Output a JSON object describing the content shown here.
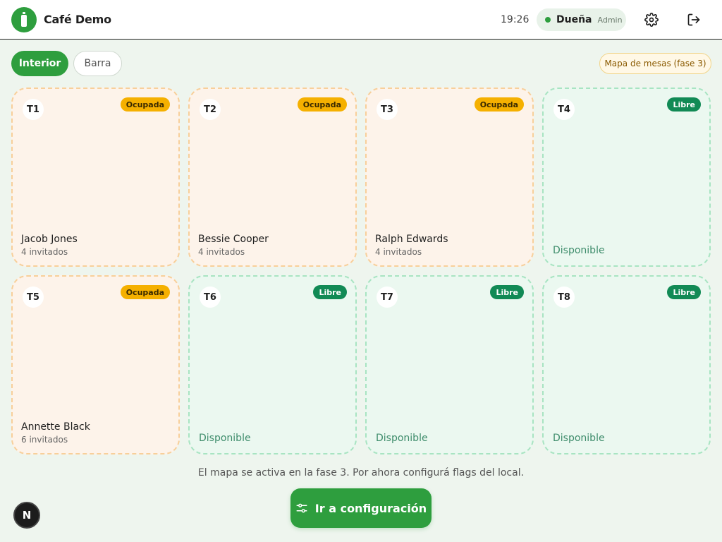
{
  "header": {
    "app_title": "Café Demo",
    "time": "19:26",
    "user_name": "Dueña",
    "user_role": "Admin",
    "brand_color": "#2e9e3e"
  },
  "tabs": [
    {
      "label": "Interior",
      "active": true
    },
    {
      "label": "Barra",
      "active": false
    }
  ],
  "phase_badge": "Mapa de mesas (fase 3)",
  "tables": [
    {
      "id": "T1",
      "status": "Ocupada",
      "guest": "Jacob Jones",
      "count": "4 invitados"
    },
    {
      "id": "T2",
      "status": "Ocupada",
      "guest": "Bessie Cooper",
      "count": "4 invitados"
    },
    {
      "id": "T3",
      "status": "Ocupada",
      "guest": "Ralph Edwards",
      "count": "4 invitados"
    },
    {
      "id": "T4",
      "status": "Libre",
      "available": "Disponible"
    },
    {
      "id": "T5",
      "status": "Ocupada",
      "guest": "Annette Black",
      "count": "6 invitados"
    },
    {
      "id": "T6",
      "status": "Libre",
      "available": "Disponible"
    },
    {
      "id": "T7",
      "status": "Libre",
      "available": "Disponible"
    },
    {
      "id": "T8",
      "status": "Libre",
      "available": "Disponible"
    }
  ],
  "footer": {
    "message": "El mapa se activa en la fase 3. Por ahora configurá flags del local.",
    "button_label": "Ir a configuración"
  },
  "dev_badge": "N",
  "icons": {
    "logo": "bottle-icon",
    "settings": "gear-icon",
    "logout": "logout-icon",
    "config": "sliders-icon"
  }
}
